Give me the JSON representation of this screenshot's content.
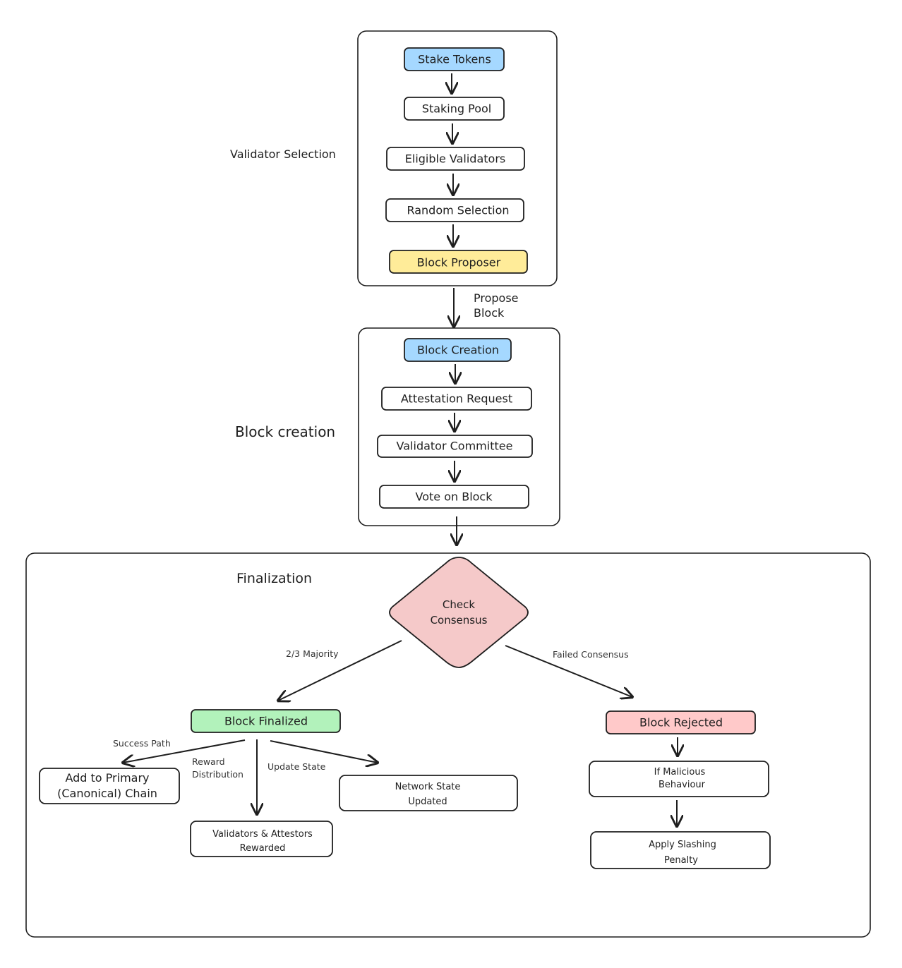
{
  "colors": {
    "blue": "#a5d8ff",
    "yellow": "#ffec99",
    "green": "#b2f2bb",
    "red": "#ffc9c9",
    "diamond": "#f5c9c9",
    "stroke": "#1e1e1e"
  },
  "groups": {
    "validator_selection": "Validator Selection",
    "block_creation": "Block creation",
    "finalization": "Finalization"
  },
  "nodes": {
    "stake_tokens": "Stake Tokens",
    "staking_pool": "Staking Pool",
    "eligible_validators": "Eligible Validators",
    "random_selection": "Random Selection",
    "block_proposer": "Block Proposer",
    "block_creation": "Block Creation",
    "attestation_request": "Attestation Request",
    "validator_committee": "Validator Committee",
    "vote_on_block": "Vote on Block",
    "check_consensus": [
      "Check",
      "Consensus"
    ],
    "block_finalized": "Block Finalized",
    "block_rejected": "Block Rejected",
    "add_to_chain": [
      "Add to Primary",
      "(Canonical) Chain"
    ],
    "network_state": [
      "Network State",
      "Updated"
    ],
    "validators_rewarded": [
      "Validators & Attestors",
      "Rewarded"
    ],
    "if_malicious": [
      "If Malicious",
      "Behaviour"
    ],
    "apply_slashing": [
      "Apply Slashing",
      "Penalty"
    ]
  },
  "edges": {
    "propose_block": [
      "Propose",
      "Block"
    ],
    "majority": "2/3 Majority",
    "failed": "Failed Consensus",
    "success_path": "Success Path",
    "reward_distribution": [
      "Reward",
      "Distribution"
    ],
    "update_state": "Update State"
  }
}
